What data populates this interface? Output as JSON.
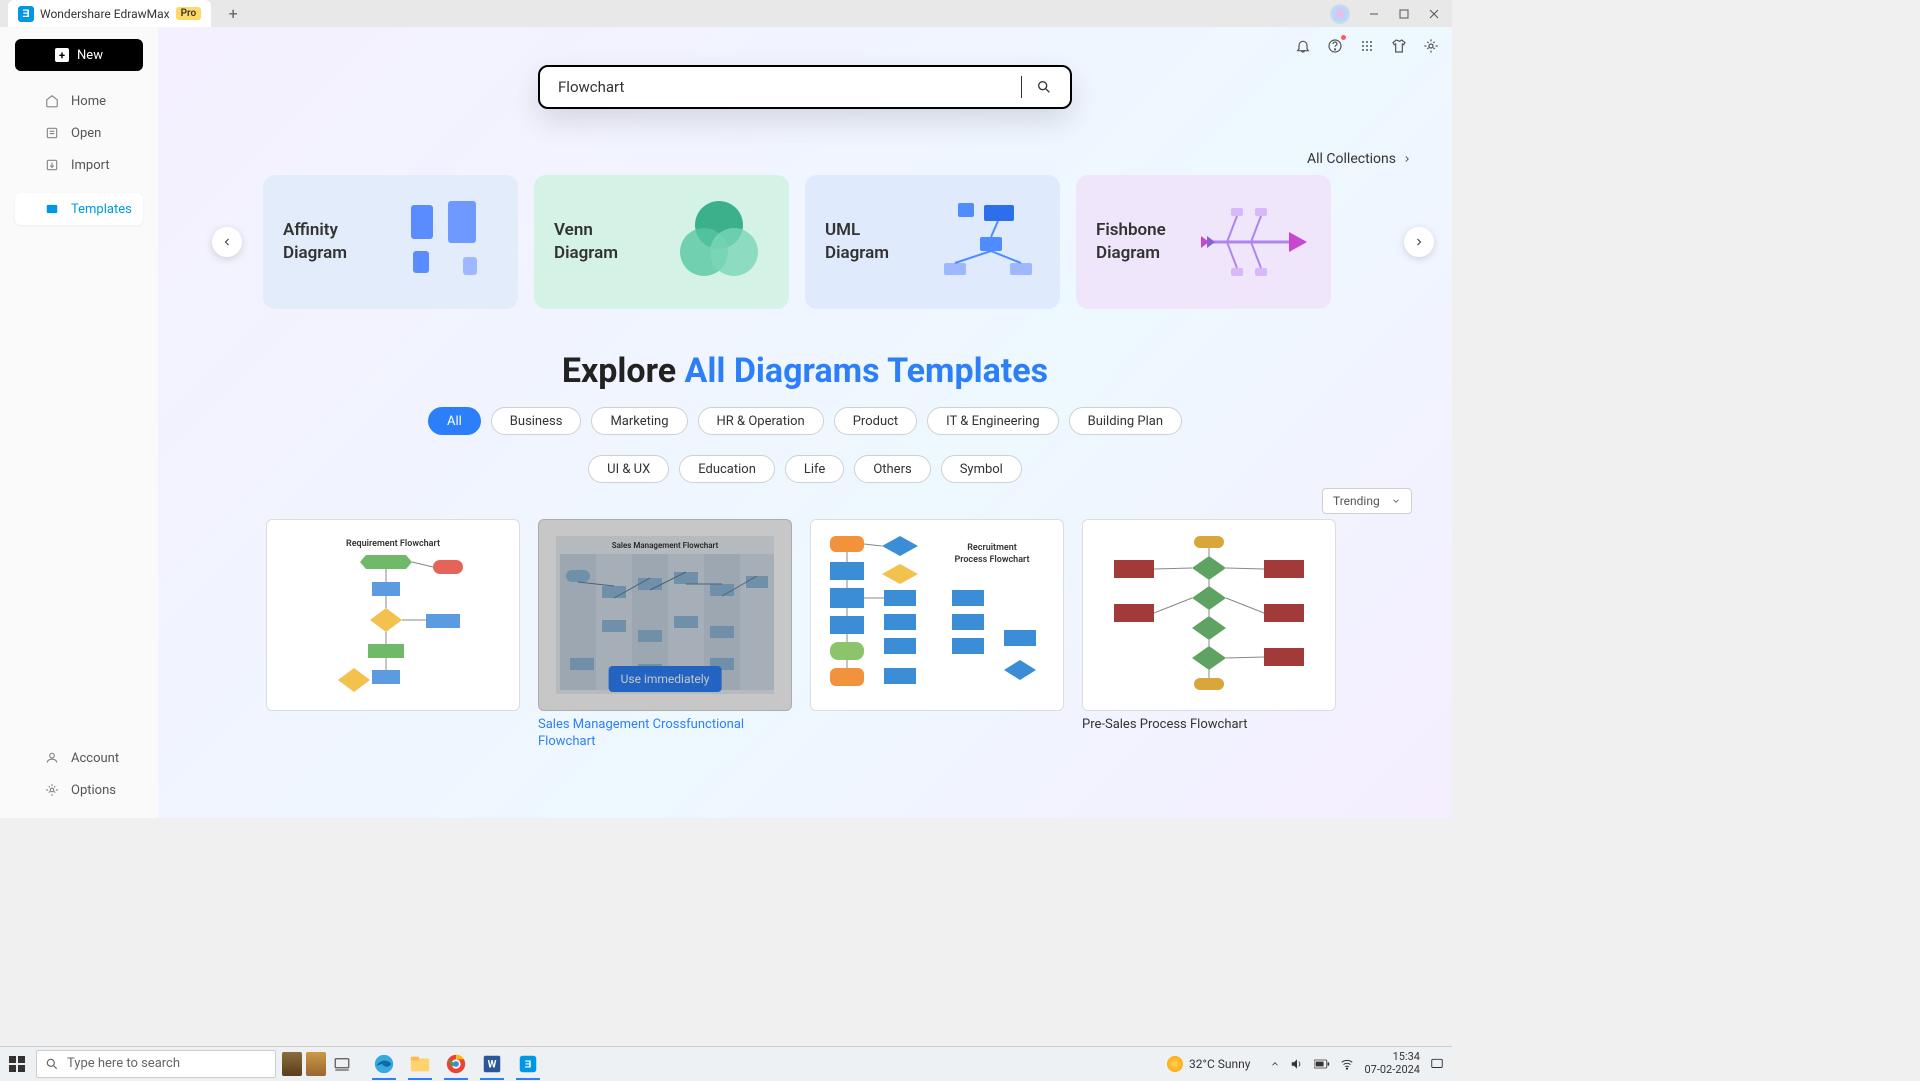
{
  "titlebar": {
    "app_title": "Wondershare EdrawMax",
    "pro_badge": "Pro"
  },
  "sidebar": {
    "new_label": "New",
    "items": [
      {
        "label": "Home"
      },
      {
        "label": "Open"
      },
      {
        "label": "Import"
      },
      {
        "label": "Templates"
      }
    ],
    "footer": [
      {
        "label": "Account"
      },
      {
        "label": "Options"
      }
    ]
  },
  "search": {
    "value": "Flowchart"
  },
  "all_collections": "All Collections",
  "carousel": [
    {
      "line1": "Affinity",
      "line2": "Diagram"
    },
    {
      "line1": "Venn",
      "line2": "Diagram"
    },
    {
      "line1": "UML",
      "line2": "Diagram"
    },
    {
      "line1": "Fishbone",
      "line2": "Diagram"
    }
  ],
  "heading": {
    "pre": "Explore ",
    "accent": "All Diagrams Templates"
  },
  "pills_row1": [
    "All",
    "Business",
    "Marketing",
    "HR & Operation",
    "Product",
    "IT & Engineering",
    "Building Plan"
  ],
  "pills_row2": [
    "UI & UX",
    "Education",
    "Life",
    "Others",
    "Symbol"
  ],
  "sort_label": "Trending",
  "templates": [
    {
      "title": "Requirement Flowchart",
      "thumb_title": "Requirement Flowchart"
    },
    {
      "title": "Sales Management Crossfunctional Flowchart",
      "thumb_title": "Sales Management Flowchart",
      "use": "Use immediately"
    },
    {
      "title": "",
      "thumb_title": "Recruitment Process Flowchart"
    },
    {
      "title": "Pre-Sales Process Flowchart",
      "thumb_title": ""
    }
  ],
  "taskbar": {
    "search_placeholder": "Type here to search",
    "weather": "32°C  Sunny",
    "time": "15:34",
    "date": "07-02-2024"
  }
}
